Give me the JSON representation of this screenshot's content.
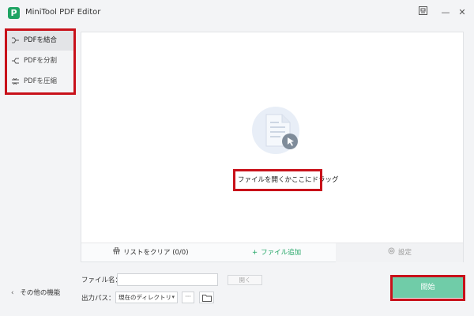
{
  "app": {
    "logo_letter": "P",
    "title": "MiniTool PDF Editor",
    "window_controls": {
      "panel_icon": "panel-icon",
      "minimize": "—",
      "close": "✕"
    }
  },
  "sidebar": {
    "items": [
      {
        "label": "PDFを結合",
        "icon": "merge-icon",
        "active": true
      },
      {
        "label": "PDFを分割",
        "icon": "split-icon",
        "active": false
      },
      {
        "label": "PDFを圧縮",
        "icon": "compress-icon",
        "active": false
      }
    ],
    "other_functions": "その他の機能",
    "other_functions_chevron": "‹"
  },
  "main": {
    "drop_icon": "document-cursor-icon",
    "drop_text": "ファイルを開くかここにドラッグ",
    "bottom_bar": {
      "clear_list": "リストをクリア (0/0)",
      "add_file_icon": "+",
      "add_file": "ファイル追加",
      "settings": "設定"
    }
  },
  "footer": {
    "file_name_label": "ファイル名：",
    "file_name_value": "",
    "open_button": "開く",
    "output_path_label": "出力パス：",
    "output_path_value": "現在のディレクトリ",
    "output_path_caret": "▾",
    "more_button": "···",
    "start_button": "開始"
  },
  "colors": {
    "brand_green": "#1fa463",
    "start_button": "#70cca8",
    "highlight_red": "#c8111a",
    "background": "#f3f4f6"
  }
}
